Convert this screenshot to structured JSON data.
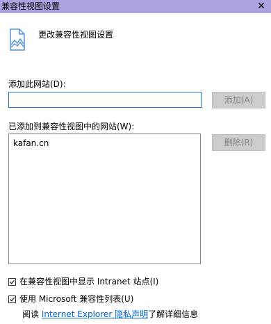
{
  "window": {
    "title": "兼容性视图设置",
    "close_glyph": "✕"
  },
  "header": {
    "icon": "page-icon",
    "text": "更改兼容性视图设置"
  },
  "add_site": {
    "label": "添加此网站(D):",
    "value": "",
    "button_label": "添加(A)"
  },
  "site_list": {
    "label": "已添加到兼容性视图中的网站(W):",
    "items": [
      "kafan.cn"
    ],
    "remove_label": "删除(R)"
  },
  "options": {
    "intranet_label": "在兼容性视图中显示 Intranet 站点(I)",
    "intranet_checked": true,
    "ms_list_label": "使用 Microsoft 兼容性列表(U)",
    "ms_list_checked": true
  },
  "footer": {
    "prefix": "阅读 ",
    "link": "Internet Explorer 隐私声明",
    "suffix": "了解详细信息"
  },
  "colors": {
    "titlebar": "#ada3e0",
    "input_border": "#1874d0",
    "link": "#0066cc",
    "button_bg": "#cccccc",
    "button_text": "#838383"
  }
}
